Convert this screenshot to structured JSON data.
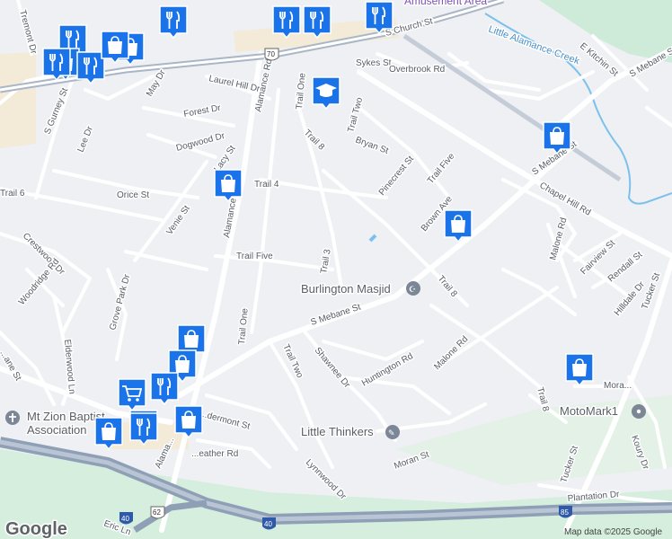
{
  "map": {
    "credit": "Map data ©2025 Google",
    "logo": "Google",
    "streets": {
      "tremont": "Tremont Dr",
      "church": "S Church St",
      "amusement": "Amusement Area",
      "little_alamance": "Little Alamance Creek",
      "kitchin": "E Kitchin St",
      "s_mebane_ne": "S Mebane St",
      "sykes": "Sykes St",
      "overbrook": "Overbrook Rd",
      "laurel_hill": "Laurel Hill Dr",
      "forest": "Forest Dr",
      "may": "May Dr",
      "gurney": "S Gurney St",
      "lee": "Lee Dr",
      "dogwood": "Dogwood Dr",
      "alamance_rd_n": "Alamance Rd",
      "trail_one_n": "Trail One",
      "trail_two_n": "Trail Two",
      "trail_8_n": "Trail 8",
      "bryan": "Bryan St",
      "pinecrest": "Pinecrest St",
      "trail_five_e": "Trail Five",
      "s_mebane_e": "S Mebane St",
      "chapel_hill": "Chapel Hill Rd",
      "brown_ave": "Brown Ave",
      "trail_4": "Trail 4",
      "lacy": "Lacy St",
      "orice": "Orice St",
      "venie": "Venie St",
      "trail_6": "Trail 6",
      "alamance_rd_s": "Alamance Rd",
      "trail_five": "Trail Five",
      "trail_3": "Trail 3",
      "malone_n": "Malone Rd",
      "fairview": "Fairview St",
      "rendall": "Rendall St",
      "tucker_n": "Tucker St",
      "crestwood": "Crestwood Dr",
      "woodridge": "Woodridge Rd",
      "grove_park": "Grove Park Dr",
      "trail_one_s": "Trail One",
      "trail_8_s": "Trail 8",
      "hilldale": "Hilldale Dr",
      "s_mebane_mid": "S Mebane St",
      "shawnee": "Shawnee Dr",
      "huntington": "Huntington Rd",
      "malone_s": "Malone Rd",
      "elderwood": "Elderwood Ln",
      "trail_two_s": "Trail Two",
      "lane": "...ane St",
      "mt_zion_1": "Mt Zion Baptist",
      "mt_zion_2": "Association",
      "dermont": "...dermont St",
      "heather": "...eather Rd",
      "alama": "Alama...",
      "lynnwood": "Lynnwood Dr",
      "moran": "Moran St",
      "trail_8_se": "Trail 8",
      "tucker_s": "Tucker St",
      "mora": "Mora...",
      "koury": "Koury Dr",
      "plantation": "Plantation Dr",
      "eric": "Eric Ln"
    },
    "shields": {
      "us70": "70",
      "i40_w": "40",
      "us62": "62",
      "i40_s": "40",
      "i85": "85"
    },
    "places": {
      "masjid": "Burlington Masjid",
      "thinkers": "Little Thinkers",
      "motomark": "MotoMark1"
    },
    "colors": {
      "land": "#eef0f3",
      "park": "#cdebd8",
      "interstate": "#8e9fb6",
      "water": "#7cc0ec",
      "poi_pin": "#1a73e8"
    },
    "pins": [
      {
        "icon": "restaurant"
      },
      {
        "icon": "restaurant"
      },
      {
        "icon": "restaurant"
      },
      {
        "icon": "restaurant"
      },
      {
        "icon": "restaurant"
      },
      {
        "icon": "shopping"
      },
      {
        "icon": "shopping"
      },
      {
        "icon": "restaurant"
      },
      {
        "icon": "restaurant"
      },
      {
        "icon": "shopping"
      },
      {
        "icon": "school"
      },
      {
        "icon": "shopping"
      },
      {
        "icon": "shopping"
      },
      {
        "icon": "shopping"
      },
      {
        "icon": "shopping"
      },
      {
        "icon": "shopping"
      },
      {
        "icon": "grocery"
      },
      {
        "icon": "restaurant"
      },
      {
        "icon": "restaurant"
      },
      {
        "icon": "restaurant"
      },
      {
        "icon": "shopping"
      },
      {
        "icon": "shopping"
      },
      {
        "icon": "shopping"
      }
    ]
  }
}
